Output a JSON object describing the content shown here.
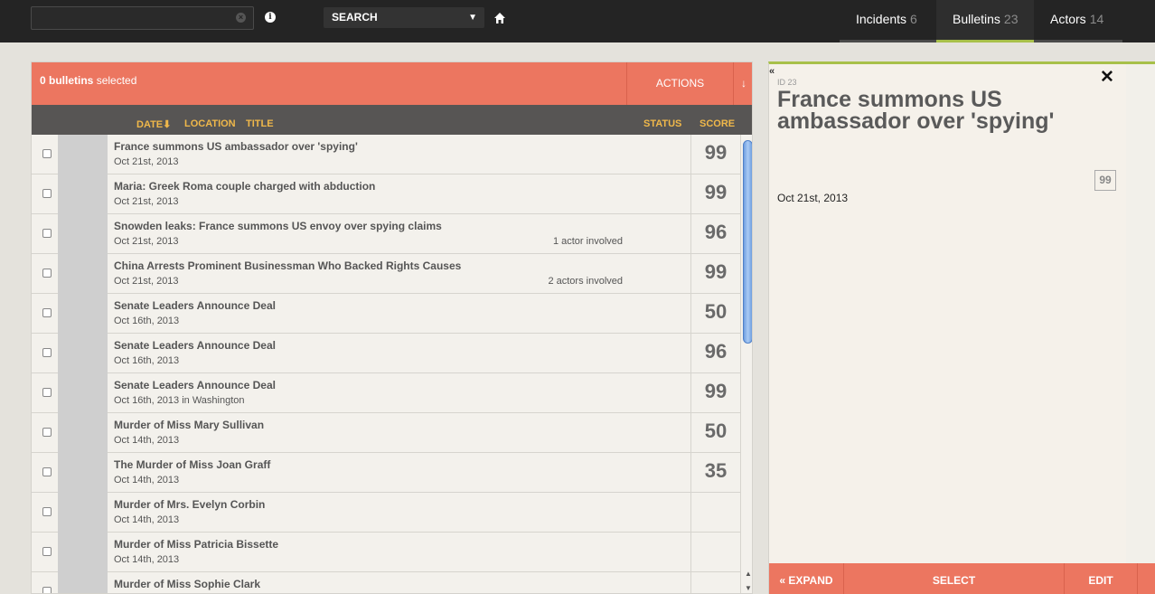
{
  "topbar": {
    "search_value": "",
    "search_mode": "SEARCH",
    "tabs": [
      {
        "label": "Incidents",
        "count": "6"
      },
      {
        "label": "Bulletins",
        "count": "23"
      },
      {
        "label": "Actors",
        "count": "14"
      }
    ]
  },
  "list": {
    "selected_count": "0 bulletins",
    "selected_suffix": "selected",
    "actions_label": "ACTIONS",
    "actions_arrow": "↓",
    "columns": {
      "date": "DATE",
      "date_sort": "⬇",
      "location": "LOCATION",
      "title": "TITLE",
      "status": "STATUS",
      "score": "SCORE"
    },
    "rows": [
      {
        "title": "France summons US ambassador over 'spying'",
        "date": "Oct 21st, 2013",
        "actors": "",
        "score": "99"
      },
      {
        "title": "Maria: Greek Roma couple charged with abduction",
        "date": "Oct 21st, 2013",
        "actors": "",
        "score": "99"
      },
      {
        "title": "Snowden leaks: France summons US envoy over spying claims",
        "date": "Oct 21st, 2013",
        "actors": "1 actor involved",
        "score": "96"
      },
      {
        "title": "China Arrests Prominent Businessman Who Backed Rights Causes",
        "date": "Oct 21st, 2013",
        "actors": "2 actors involved",
        "score": "99"
      },
      {
        "title": "Senate Leaders Announce Deal",
        "date": "Oct 16th, 2013",
        "actors": "",
        "score": "50"
      },
      {
        "title": "Senate Leaders Announce Deal",
        "date": "Oct 16th, 2013",
        "actors": "",
        "score": "96"
      },
      {
        "title": "Senate Leaders Announce Deal",
        "date": "Oct 16th, 2013 in Washington",
        "actors": "",
        "score": "99"
      },
      {
        "title": "Murder of Miss Mary Sullivan",
        "date": "Oct 14th, 2013",
        "actors": "",
        "score": "50"
      },
      {
        "title": "The Murder of Miss Joan Graff",
        "date": "Oct 14th, 2013",
        "actors": "",
        "score": "35"
      },
      {
        "title": "Murder of Mrs. Evelyn Corbin",
        "date": "Oct 14th, 2013",
        "actors": "",
        "score": ""
      },
      {
        "title": "Murder of Miss Patricia Bissette",
        "date": "Oct 14th, 2013",
        "actors": "",
        "score": ""
      },
      {
        "title": "Murder of Miss Sophie Clark",
        "date": "",
        "actors": "",
        "score": ""
      }
    ]
  },
  "detail": {
    "collapse": "«",
    "close": "✕",
    "id": "ID 23",
    "title": "France summons US ambassador over 'spying'",
    "score": "99",
    "date": "Oct 21st, 2013",
    "footer": {
      "expand": "« EXPAND",
      "select": "SELECT",
      "edit": "EDIT"
    }
  },
  "colors": {
    "accent": "#ec7660",
    "topbar": "#242424",
    "active_tab_underline": "#a8c04a",
    "header_text": "#f0b84a"
  },
  "icons": [
    "clear-icon",
    "info-icon",
    "chevron-down-icon",
    "home-icon",
    "close-icon",
    "collapse-icon",
    "sort-down-icon"
  ]
}
